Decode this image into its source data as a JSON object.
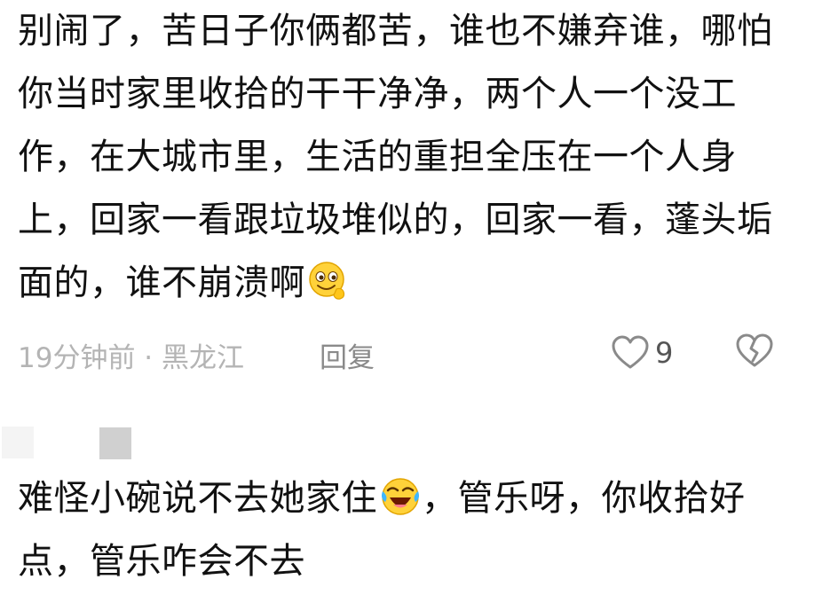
{
  "comments": [
    {
      "text": "别闹了，苦日子你俩都苦，谁也不嫌弃谁，哪怕你当时家里收拾的干干净净，两个人一个没工作，在大城市里，生活的重担全压在一个人身上，回家一看跟垃圾堆似的，回家一看，蓬头垢面的，谁不崩溃啊",
      "emoji": "smirk-thumbs-emoji",
      "meta": "19分钟前 · 黑龙江",
      "reply_label": "回复",
      "like_count": "9"
    },
    {
      "text_before_emoji": "难怪小碗说不去她家住",
      "emoji": "laugh-cry-emoji",
      "text_after_emoji": "，管乐呀，你收拾好点，管乐咋会不去"
    }
  ],
  "colors": {
    "text": "#111111",
    "meta": "#b4b4b4",
    "reply": "#8a8a8a",
    "emoji_face": "#ffd23a"
  }
}
